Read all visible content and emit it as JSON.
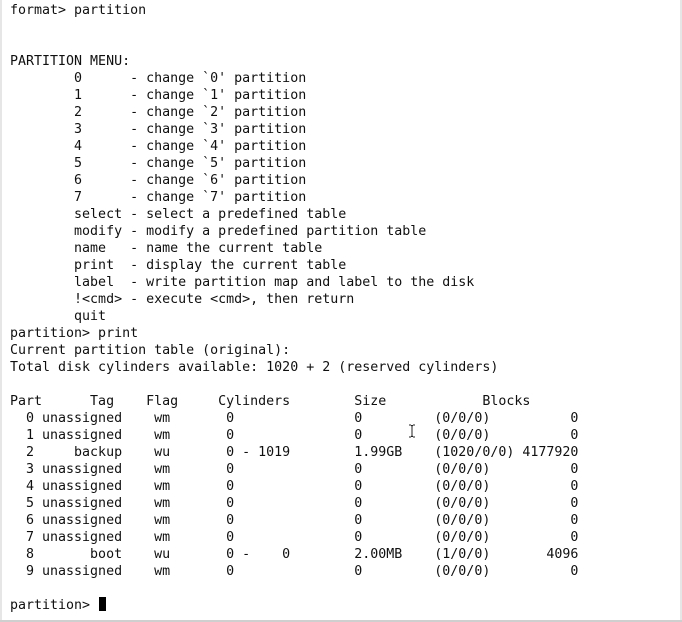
{
  "window": {
    "app": "terminal"
  },
  "terminal": {
    "lines": [
      "format> partition",
      "",
      "",
      "PARTITION MENU:",
      "        0      - change `0' partition",
      "        1      - change `1' partition",
      "        2      - change `2' partition",
      "        3      - change `3' partition",
      "        4      - change `4' partition",
      "        5      - change `5' partition",
      "        6      - change `6' partition",
      "        7      - change `7' partition",
      "        select - select a predefined table",
      "        modify - modify a predefined partition table",
      "        name   - name the current table",
      "        print  - display the current table",
      "        label  - write partition map and label to the disk",
      "        !<cmd> - execute <cmd>, then return",
      "        quit",
      "partition> print",
      "Current partition table (original):",
      "Total disk cylinders available: 1020 + 2 (reserved cylinders)",
      "",
      "Part      Tag    Flag     Cylinders        Size            Blocks",
      "  0 unassigned    wm       0               0         (0/0/0)          0",
      "  1 unassigned    wm       0               0         (0/0/0)          0",
      "  2     backup    wu       0 - 1019        1.99GB    (1020/0/0) 4177920",
      "  3 unassigned    wm       0               0         (0/0/0)          0",
      "  4 unassigned    wm       0               0         (0/0/0)          0",
      "  5 unassigned    wm       0               0         (0/0/0)          0",
      "  6 unassigned    wm       0               0         (0/0/0)          0",
      "  7 unassigned    wm       0               0         (0/0/0)          0",
      "  8       boot    wu       0 -    0        2.00MB    (1/0/0)       4096",
      "  9 unassigned    wm       0               0         (0/0/0)          0",
      ""
    ],
    "prompt": "partition> ",
    "input_value": ""
  },
  "colors": {
    "background": "#ffffff",
    "text": "#101010",
    "cursor": "#000000"
  },
  "icons": {
    "mouse_pointer": "text-cursor-ibeam-icon"
  }
}
